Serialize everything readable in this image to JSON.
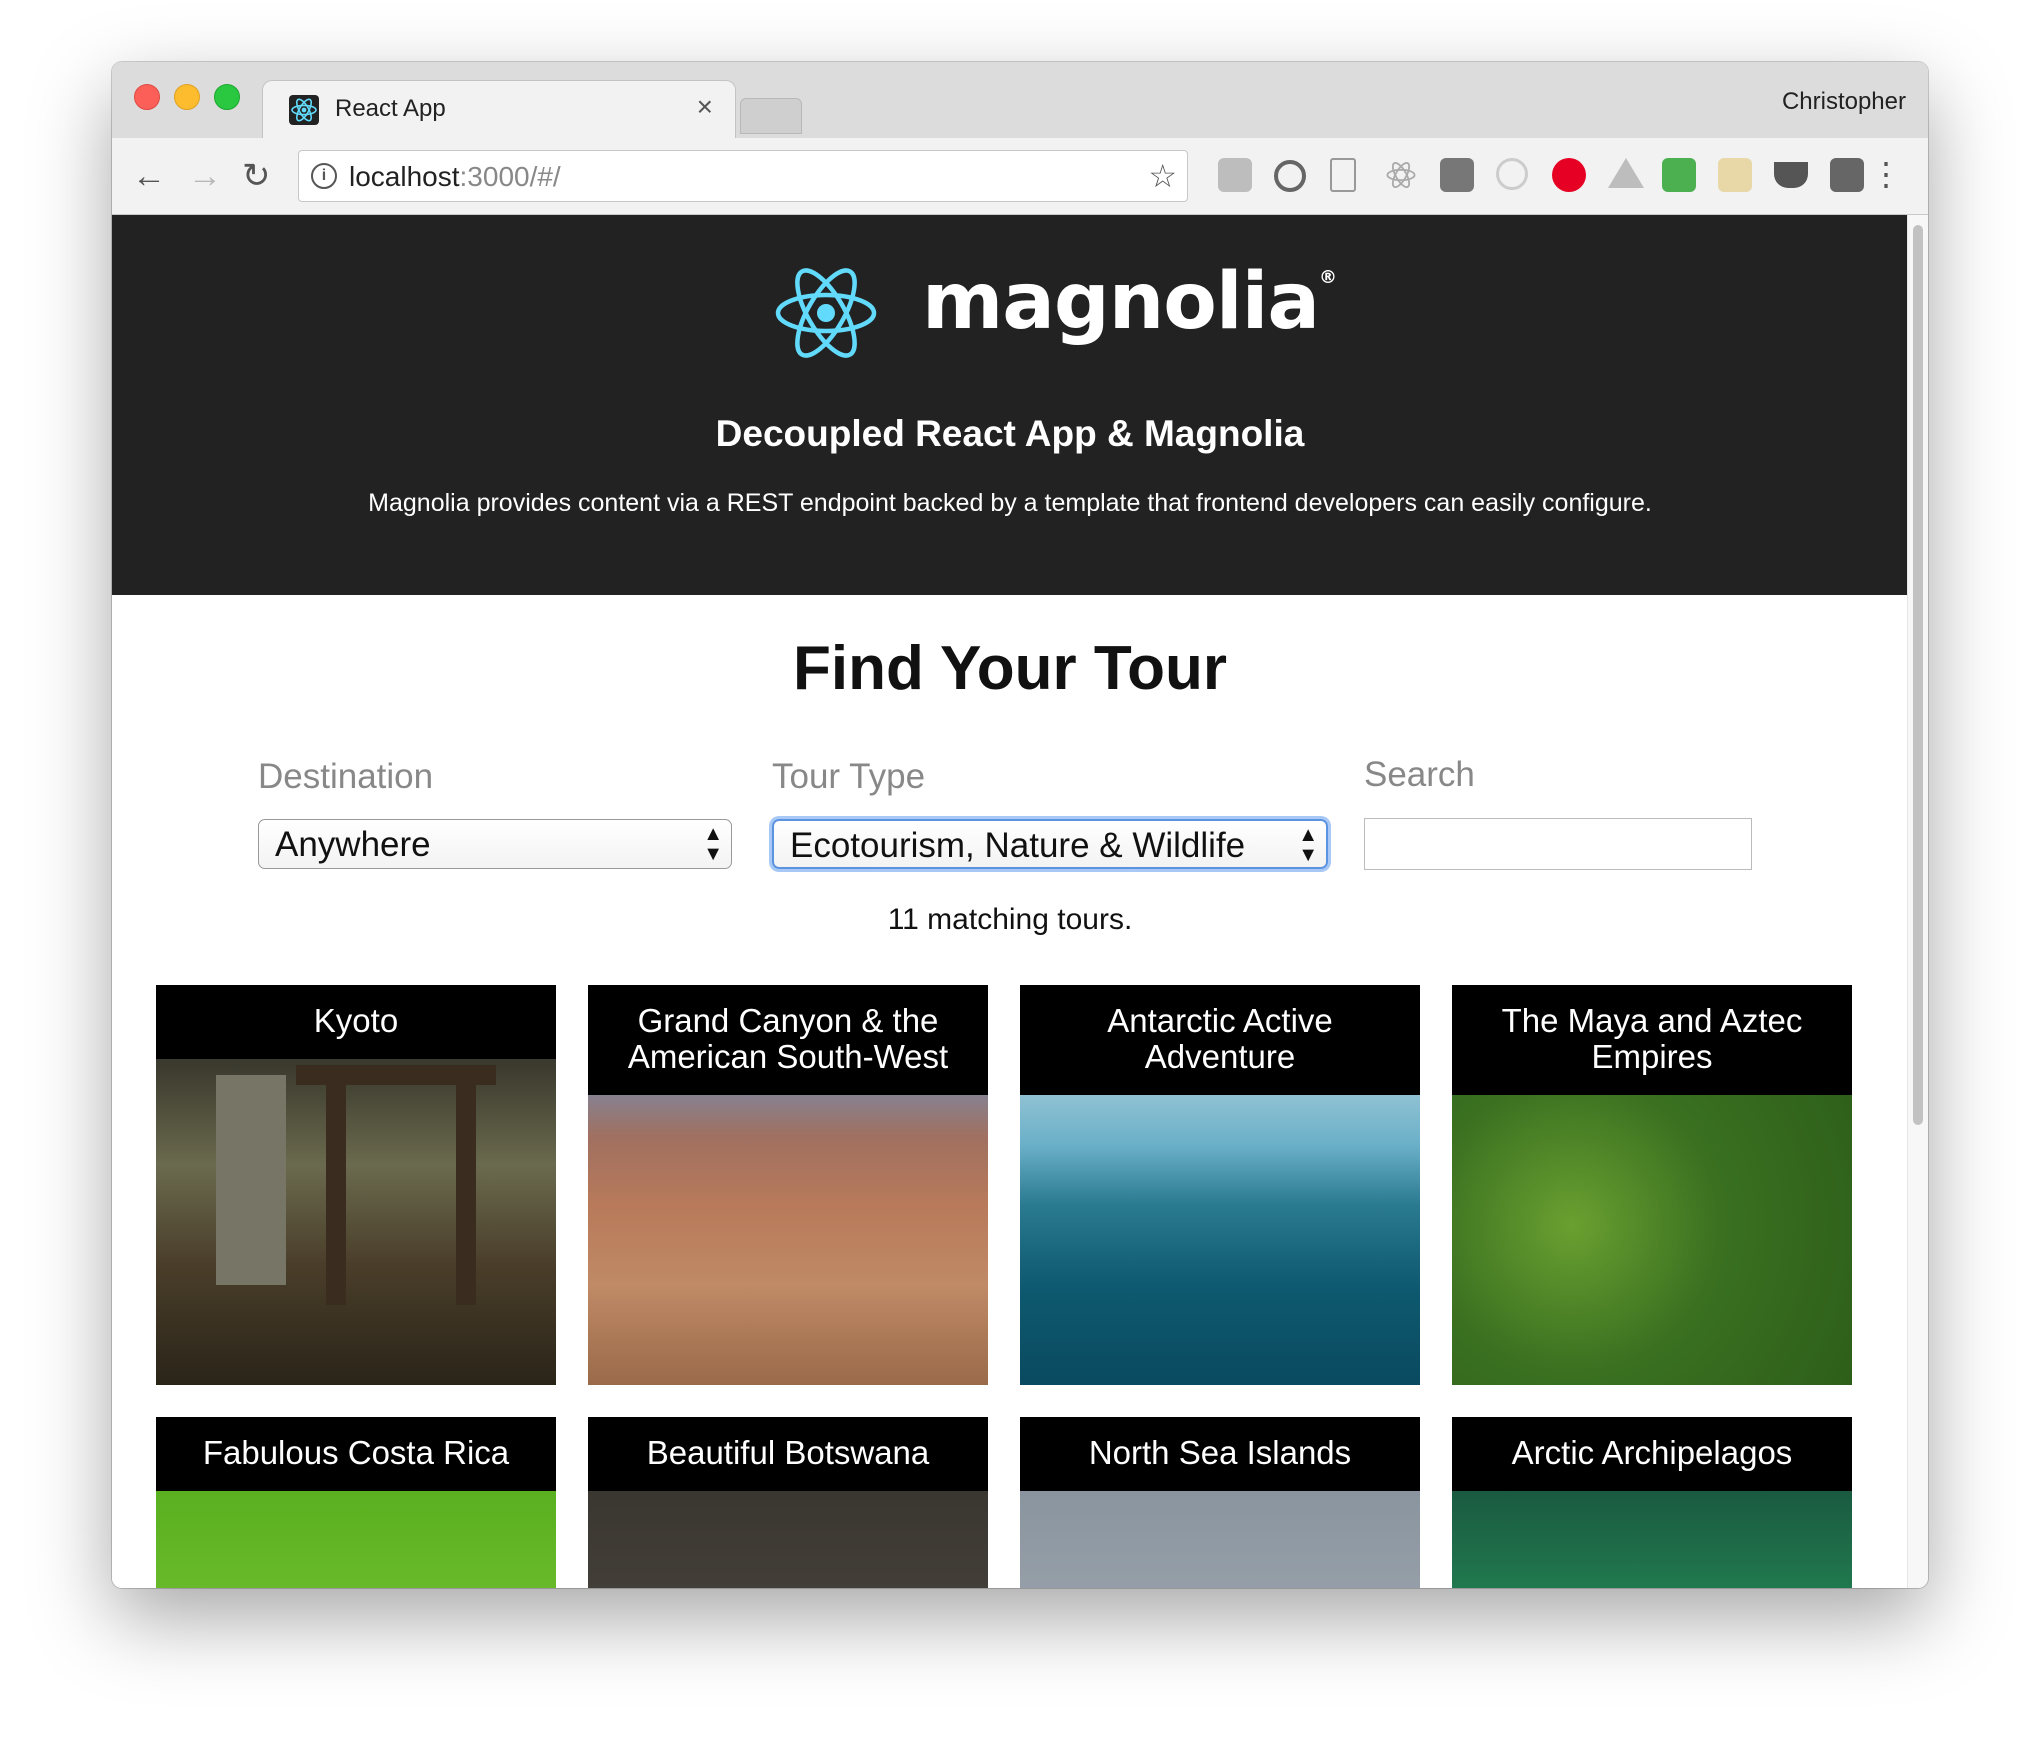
{
  "browser": {
    "tab_title": "React App",
    "tab_close": "×",
    "profile_name": "Christopher",
    "url_host": "localhost",
    "url_rest": ":3000/#/",
    "back_glyph": "←",
    "forward_glyph": "→",
    "reload_glyph": "↻",
    "star_glyph": "☆",
    "info_glyph": "i",
    "menu_glyph": "⋮",
    "extensions": [
      "invision-icon",
      "power-icon",
      "code-icon",
      "react-devtools-icon",
      "fullscreen-icon",
      "target-icon",
      "pinterest-icon",
      "google-drive-icon",
      "cors-icon",
      "wheat-icon",
      "pocket-icon",
      "shield-icon"
    ]
  },
  "hero": {
    "logo_text": "magnolia",
    "logo_reg": "®",
    "title": "Decoupled React App & Magnolia",
    "subtitle": "Magnolia provides content via a REST endpoint backed by a template that frontend developers can easily configure."
  },
  "main": {
    "heading": "Find Your Tour",
    "filters": {
      "destination_label": "Destination",
      "destination_value": "Anywhere",
      "tour_type_label": "Tour Type",
      "tour_type_value": "Ecotourism, Nature & Wildlife",
      "search_label": "Search",
      "search_value": ""
    },
    "result_count": "11 matching tours.",
    "tours": [
      {
        "title": "Kyoto"
      },
      {
        "title": "Grand Canyon & the American South-West"
      },
      {
        "title": "Antarctic Active Adventure"
      },
      {
        "title": "The Maya and Aztec Empires"
      },
      {
        "title": "Fabulous Costa Rica"
      },
      {
        "title": "Beautiful Botswana"
      },
      {
        "title": "North Sea Islands"
      },
      {
        "title": "Arctic Archipelagos"
      }
    ]
  },
  "colors": {
    "hero_bg": "#222222",
    "react_blue": "#61dafb",
    "focus_ring": "#5b93e0"
  }
}
